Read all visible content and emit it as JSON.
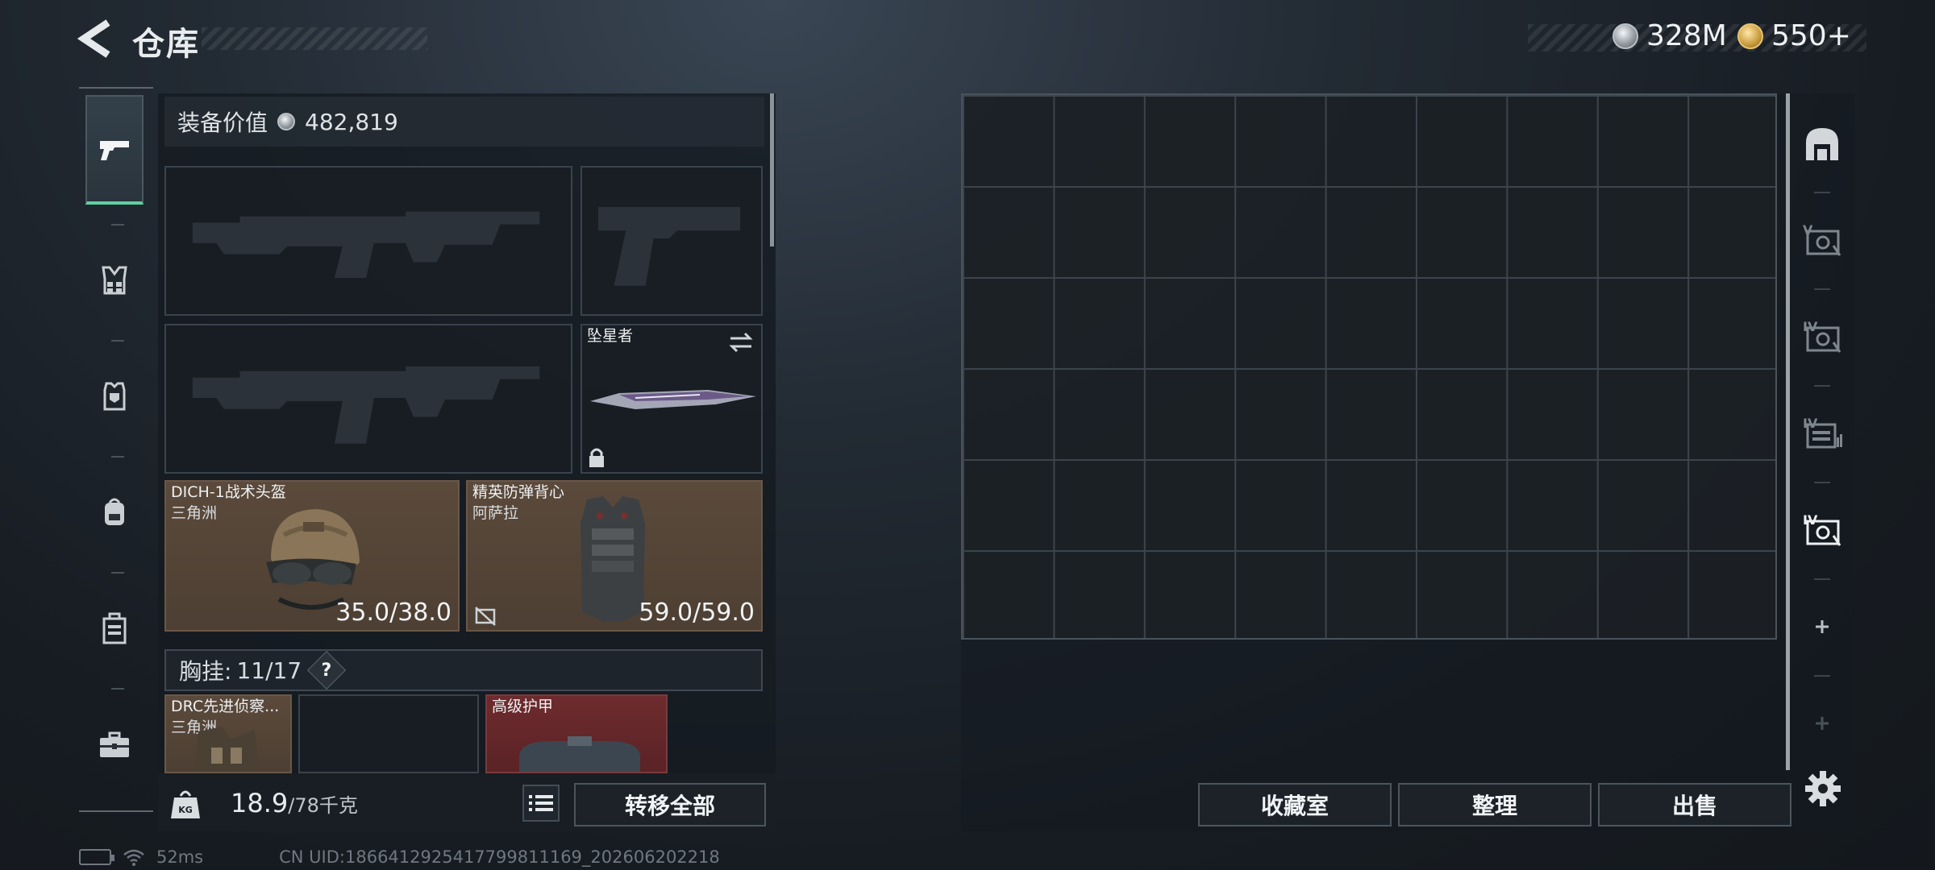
{
  "header": {
    "title": "仓库",
    "currencies": [
      {
        "icon": "silver-coin-icon",
        "amount": "328M"
      },
      {
        "icon": "gold-coin-icon",
        "amount": "550+"
      }
    ]
  },
  "categories": [
    {
      "icon": "pistol-icon",
      "active": true
    },
    {
      "icon": "chest-rig-icon",
      "active": false
    },
    {
      "icon": "vest-icon",
      "active": false
    },
    {
      "icon": "backpack-icon",
      "active": false
    },
    {
      "icon": "case-icon",
      "active": false
    },
    {
      "icon": "toolbox-icon",
      "active": false
    }
  ],
  "loadout": {
    "value_label": "装备价值",
    "value": "482,819",
    "melee": {
      "name": "坠星者"
    },
    "helmet": {
      "name": "DICH-1战术头盔",
      "maker": "三角洲",
      "durability": "35.0/38.0"
    },
    "armor": {
      "name": "精英防弹背心",
      "maker": "阿萨拉",
      "durability": "59.0/59.0"
    },
    "chest_rig": {
      "label": "胸挂:",
      "capacity": "11/17",
      "help": "?"
    },
    "rig_item": {
      "name": "DRC先进侦察...",
      "maker": "三角洲"
    },
    "backpack_item": {
      "name": "高级护甲"
    }
  },
  "footer": {
    "weight": "18.9",
    "weight_max": "/78千克",
    "transfer_all": "转移全部",
    "collection_room": "收藏室",
    "organize": "整理",
    "sell": "出售"
  },
  "storage_tabs": [
    {
      "icon": "safe-house-icon"
    },
    {
      "icon": "storage-tier-v-icon"
    },
    {
      "icon": "storage-tier-iv-icon"
    },
    {
      "icon": "storage-tier-iv-shelf-icon"
    },
    {
      "icon": "storage-tier-iv-active-icon"
    },
    {
      "icon": "add-storage-icon"
    },
    {
      "icon": "add-storage-disabled-icon"
    }
  ],
  "status": {
    "ping": "52ms",
    "uid": "CN UID:1866412925417799811169_202606202218"
  },
  "colors": {
    "accent": "#5fd0a1",
    "gear_card": "#5b4a3b",
    "rare_card": "#6e2b2e"
  }
}
